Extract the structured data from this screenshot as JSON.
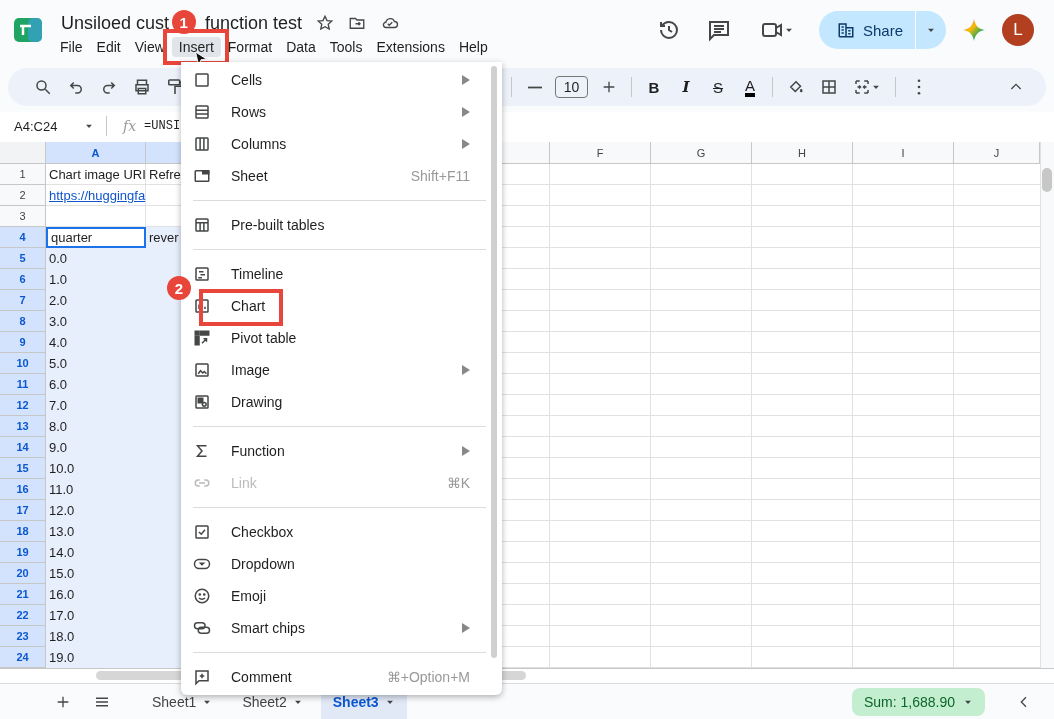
{
  "header": {
    "title_parts": [
      "Unsiloed cust",
      "function test"
    ],
    "avatar": "L",
    "share": "Share"
  },
  "menubar": [
    {
      "label": "File",
      "selected": false
    },
    {
      "label": "Edit",
      "selected": false
    },
    {
      "label": "View",
      "selected": false
    },
    {
      "label": "Insert",
      "selected": true,
      "callout": "1"
    },
    {
      "label": "Format",
      "selected": false
    },
    {
      "label": "Data",
      "selected": false
    },
    {
      "label": "Tools",
      "selected": false
    },
    {
      "label": "Extensions",
      "selected": false
    },
    {
      "label": "Help",
      "selected": false
    }
  ],
  "toolbar": {
    "font_size": "10",
    "format_buttons": [
      "B",
      "I",
      "S",
      "A"
    ]
  },
  "formula_bar": {
    "name_box": "A4:C24",
    "fx": "fx",
    "formula": "=UNSI"
  },
  "columns": [
    {
      "label": "A",
      "selected": true
    },
    {
      "label": "F",
      "selected": false
    },
    {
      "label": "G",
      "selected": false
    },
    {
      "label": "H",
      "selected": false
    },
    {
      "label": "I",
      "selected": false
    },
    {
      "label": "J",
      "selected": false
    }
  ],
  "rows": [
    {
      "num": "1",
      "selected": false,
      "cells": [
        {
          "text": "Chart image URI",
          "kind": "text"
        },
        {
          "text": "Refre",
          "kind": "text"
        }
      ]
    },
    {
      "num": "2",
      "selected": false,
      "cells": [
        {
          "text": "https://huggingfa",
          "kind": "link"
        }
      ]
    },
    {
      "num": "3",
      "selected": false,
      "cells": []
    },
    {
      "num": "4",
      "selected": true,
      "cells": [
        {
          "text": "quarter",
          "kind": "text",
          "active": true
        },
        {
          "text": "rever",
          "kind": "text"
        }
      ]
    },
    {
      "num": "5",
      "selected": true,
      "cells": [
        {
          "text": "0.0",
          "kind": "text"
        }
      ]
    },
    {
      "num": "6",
      "selected": true,
      "cells": [
        {
          "text": "1.0",
          "kind": "text"
        }
      ]
    },
    {
      "num": "7",
      "selected": true,
      "cells": [
        {
          "text": "2.0",
          "kind": "text"
        }
      ]
    },
    {
      "num": "8",
      "selected": true,
      "cells": [
        {
          "text": "3.0",
          "kind": "text"
        }
      ]
    },
    {
      "num": "9",
      "selected": true,
      "cells": [
        {
          "text": "4.0",
          "kind": "text"
        }
      ]
    },
    {
      "num": "10",
      "selected": true,
      "cells": [
        {
          "text": "5.0",
          "kind": "text"
        }
      ]
    },
    {
      "num": "11",
      "selected": true,
      "cells": [
        {
          "text": "6.0",
          "kind": "text"
        }
      ]
    },
    {
      "num": "12",
      "selected": true,
      "cells": [
        {
          "text": "7.0",
          "kind": "text"
        }
      ]
    },
    {
      "num": "13",
      "selected": true,
      "cells": [
        {
          "text": "8.0",
          "kind": "text"
        }
      ]
    },
    {
      "num": "14",
      "selected": true,
      "cells": [
        {
          "text": "9.0",
          "kind": "text"
        }
      ]
    },
    {
      "num": "15",
      "selected": true,
      "cells": [
        {
          "text": "10.0",
          "kind": "text"
        }
      ]
    },
    {
      "num": "16",
      "selected": true,
      "cells": [
        {
          "text": "11.0",
          "kind": "text"
        }
      ]
    },
    {
      "num": "17",
      "selected": true,
      "cells": [
        {
          "text": "12.0",
          "kind": "text"
        }
      ]
    },
    {
      "num": "18",
      "selected": true,
      "cells": [
        {
          "text": "13.0",
          "kind": "text"
        }
      ]
    },
    {
      "num": "19",
      "selected": true,
      "cells": [
        {
          "text": "14.0",
          "kind": "text"
        }
      ]
    },
    {
      "num": "20",
      "selected": true,
      "cells": [
        {
          "text": "15.0",
          "kind": "text"
        }
      ]
    },
    {
      "num": "21",
      "selected": true,
      "cells": [
        {
          "text": "16.0",
          "kind": "text"
        }
      ]
    },
    {
      "num": "22",
      "selected": true,
      "cells": [
        {
          "text": "17.0",
          "kind": "text"
        }
      ]
    },
    {
      "num": "23",
      "selected": true,
      "cells": [
        {
          "text": "18.0",
          "kind": "text"
        }
      ]
    },
    {
      "num": "24",
      "selected": true,
      "cells": [
        {
          "text": "19.0",
          "kind": "text"
        }
      ]
    }
  ],
  "insert_menu": [
    {
      "kind": "item",
      "label": "Cells",
      "submenu": true,
      "disabled": false
    },
    {
      "kind": "item",
      "label": "Rows",
      "submenu": true,
      "disabled": false
    },
    {
      "kind": "item",
      "label": "Columns",
      "submenu": true,
      "disabled": false
    },
    {
      "kind": "item",
      "label": "Sheet",
      "shortcut": "Shift+F11",
      "submenu": false,
      "disabled": false
    },
    {
      "kind": "divider"
    },
    {
      "kind": "item",
      "label": "Pre-built tables",
      "submenu": false,
      "disabled": false
    },
    {
      "kind": "divider"
    },
    {
      "kind": "item",
      "label": "Timeline",
      "submenu": false,
      "disabled": false
    },
    {
      "kind": "item",
      "label": "Chart",
      "submenu": false,
      "disabled": false,
      "callout": "2"
    },
    {
      "kind": "item",
      "label": "Pivot table",
      "submenu": false,
      "disabled": false
    },
    {
      "kind": "item",
      "label": "Image",
      "submenu": true,
      "disabled": false
    },
    {
      "kind": "item",
      "label": "Drawing",
      "submenu": false,
      "disabled": false
    },
    {
      "kind": "divider"
    },
    {
      "kind": "item",
      "label": "Function",
      "submenu": true,
      "disabled": false
    },
    {
      "kind": "item",
      "label": "Link",
      "shortcut": "⌘K",
      "submenu": false,
      "disabled": true
    },
    {
      "kind": "divider"
    },
    {
      "kind": "item",
      "label": "Checkbox",
      "submenu": false,
      "disabled": false
    },
    {
      "kind": "item",
      "label": "Dropdown",
      "submenu": false,
      "disabled": false
    },
    {
      "kind": "item",
      "label": "Emoji",
      "submenu": false,
      "disabled": false
    },
    {
      "kind": "item",
      "label": "Smart chips",
      "submenu": true,
      "disabled": false
    },
    {
      "kind": "divider"
    },
    {
      "kind": "item",
      "label": "Comment",
      "shortcut": "⌘+Option+M",
      "submenu": false,
      "disabled": false
    }
  ],
  "sheet_tabs": [
    {
      "label": "Sheet1",
      "selected": false
    },
    {
      "label": "Sheet2",
      "selected": false
    },
    {
      "label": "Sheet3",
      "selected": true
    }
  ],
  "status": {
    "sum": "Sum: 1,688.90"
  }
}
